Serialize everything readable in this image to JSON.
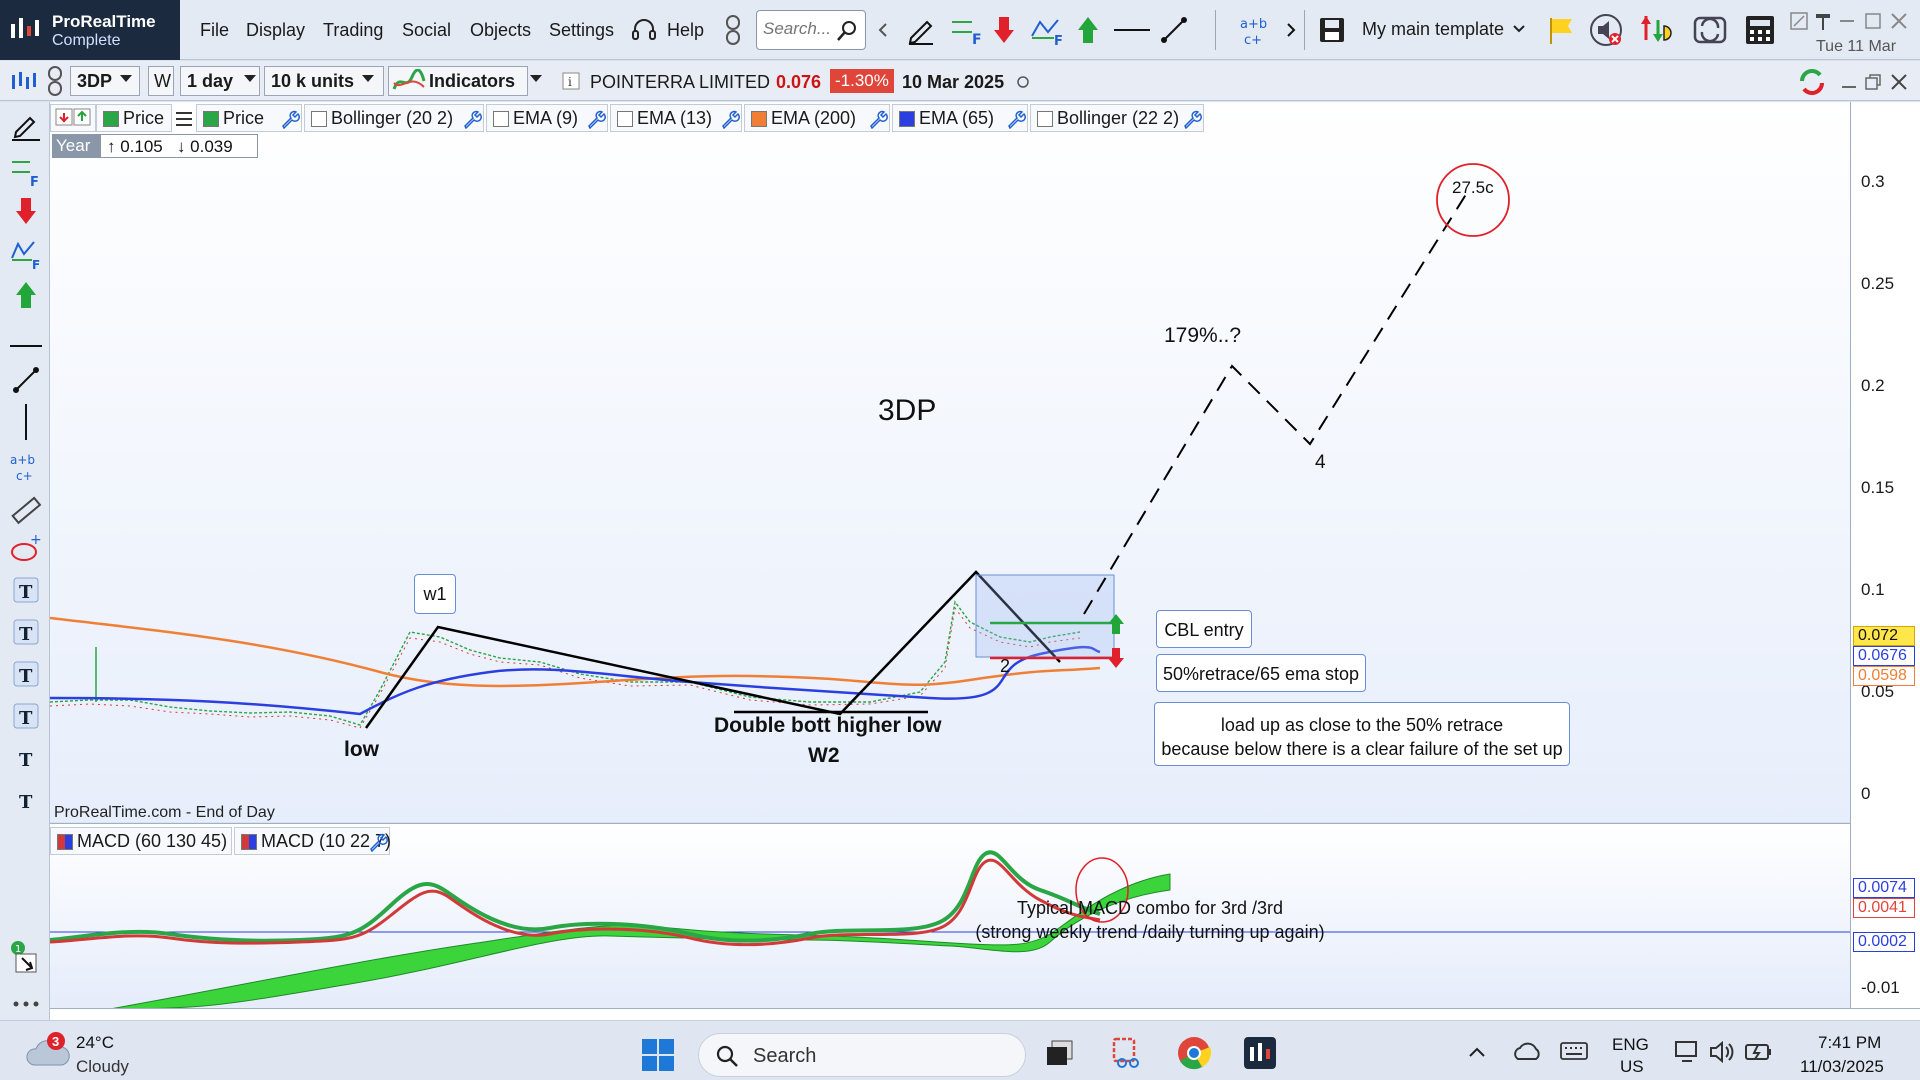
{
  "app": {
    "name": "ProRealTime",
    "edition": "Complete",
    "menu": [
      "File",
      "Display",
      "Trading",
      "Social",
      "Objects",
      "Settings"
    ],
    "help_label": "Help",
    "search_placeholder": "Search...",
    "template_label": "My main template",
    "top_date": "Tue 11 Mar"
  },
  "toolbar": {
    "symbol": "3DP",
    "timeframe_w": "W",
    "period": "1 day",
    "units": "10 k units",
    "indicators_label": "Indicators",
    "instrument_name": "POINTERRA LIMITED",
    "last_price": "0.076",
    "change": "-1.30%",
    "quote_date": "10 Mar 2025"
  },
  "legend": {
    "items": [
      {
        "label": "Price",
        "color": "#2aa646"
      },
      {
        "label": "Price",
        "color": "#2aa646"
      },
      {
        "label": "Bollinger (20 2)",
        "color": "#ffffff"
      },
      {
        "label": "EMA (9)",
        "color": "#ffffff"
      },
      {
        "label": "EMA (13)",
        "color": "#ffffff"
      },
      {
        "label": "EMA (200)",
        "color": "#f07f35"
      },
      {
        "label": "EMA (65)",
        "color": "#2b3fe0"
      },
      {
        "label": "Bollinger (22 2)",
        "color": "#ffffff"
      }
    ],
    "year_label": "Year",
    "year_high": "↑ 0.105",
    "year_low": "↓ 0.039"
  },
  "annotations": {
    "symbol_title": "3DP",
    "target": "27.5c",
    "projection": "179%..?",
    "wave4": "4",
    "wave2": "2",
    "w1": "w1",
    "low": "low",
    "double_bottom": "Double bott higher low",
    "w2": "W2",
    "cbl_entry": "CBL entry",
    "stop": "50%retrace/65 ema stop",
    "note_line1": "load up as close to the 50% retrace",
    "note_line2": "because below there is a clear failure of the set up",
    "macd_note_line1": "Typical MACD combo for 3rd /3rd",
    "macd_note_line2": "(strong weekly trend /daily turning up again)",
    "source": "ProRealTime.com - End of Day"
  },
  "price_axis": {
    "ticks": [
      "0.3",
      "0.25",
      "0.2",
      "0.15",
      "0.1",
      "0.05",
      "0"
    ],
    "badges": [
      {
        "value": "0.072",
        "color": "#d4a800",
        "bg": "#ffe64a"
      },
      {
        "value": "0.0676",
        "color": "#2b3fe0",
        "bg": "#ffffff"
      },
      {
        "value": "0.0598",
        "color": "#f07f35",
        "bg": "#ffffff"
      }
    ]
  },
  "macd_panel": {
    "legend": [
      "MACD (60 130 45)",
      "MACD (10 22 7)"
    ],
    "ticks": [
      "-0.01"
    ],
    "badges": [
      {
        "value": "0.0074",
        "color": "#2b3fe0"
      },
      {
        "value": "0.0041",
        "color": "#e0453a"
      },
      {
        "value": "0.0002",
        "color": "#2b3fe0"
      }
    ]
  },
  "taskbar": {
    "weather_temp": "24°C",
    "weather_desc": "Cloudy",
    "weather_badge": "3",
    "search_label": "Search",
    "lang_top": "ENG",
    "lang_bottom": "US",
    "time": "7:41 PM",
    "date": "11/03/2025"
  }
}
